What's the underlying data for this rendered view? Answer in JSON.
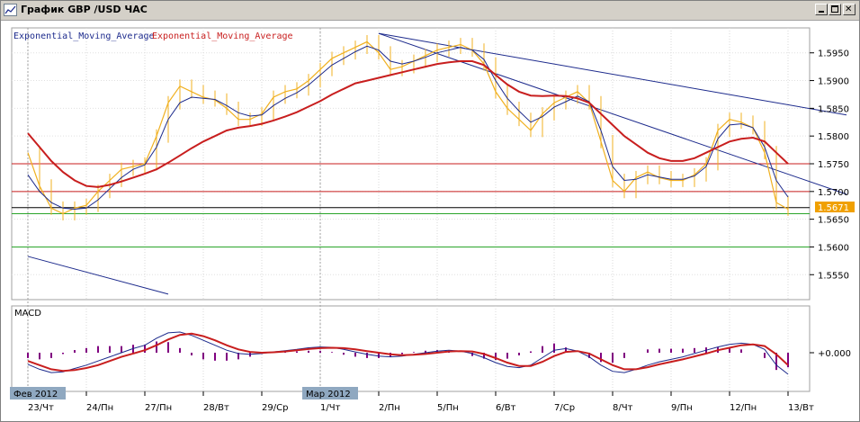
{
  "window": {
    "title": "График GBP /USD ЧАС",
    "buttons": [
      "minimize",
      "maximize",
      "close"
    ]
  },
  "chart_data": [
    {
      "type": "line",
      "name": "price-panel",
      "legend": [
        {
          "label": "Exponential_Moving_Average",
          "color": "#1c2a8c"
        },
        {
          "label": "Exponential_Moving_Average",
          "color": "#c81e1e"
        }
      ],
      "ylim": [
        1.5505,
        1.5995
      ],
      "yticks": [
        "1.5950",
        "1.5900",
        "1.5850",
        "1.5800",
        "1.5750",
        "1.5700",
        "1.5650",
        "1.5600",
        "1.5550"
      ],
      "current_price": "1.5671",
      "colors": {
        "price": "#f0b020",
        "ema_fast": "#1c2a8c",
        "ema_slow": "#c81e1e",
        "hline_red": "#c81e1e",
        "hline_green": "#2aa52a",
        "trend": "#1c2a8c"
      },
      "horizontal_lines": [
        {
          "value": 1.575,
          "color": "#c81e1e"
        },
        {
          "value": 1.57,
          "color": "#c81e1e"
        },
        {
          "value": 1.5671,
          "color": "#000000"
        },
        {
          "value": 1.566,
          "color": "#2aa52a"
        },
        {
          "value": 1.56,
          "color": "#2aa52a"
        }
      ],
      "trendlines": [
        {
          "x1": 6.0,
          "y1": 1.5985,
          "x2": 14.0,
          "y2": 1.5838
        },
        {
          "x1": 6.0,
          "y1": 1.5985,
          "x2": 14.0,
          "y2": 1.5695
        },
        {
          "x1": 0.0,
          "y1": 1.5583,
          "x2": 2.4,
          "y2": 1.5515
        }
      ],
      "x": [
        0.0,
        0.2,
        0.4,
        0.6,
        0.8,
        1.0,
        1.2,
        1.4,
        1.6,
        1.8,
        2.0,
        2.2,
        2.4,
        2.6,
        2.8,
        3.0,
        3.2,
        3.4,
        3.6,
        3.8,
        4.0,
        4.2,
        4.4,
        4.6,
        4.8,
        5.0,
        5.2,
        5.4,
        5.6,
        5.8,
        6.0,
        6.2,
        6.4,
        6.6,
        6.8,
        7.0,
        7.2,
        7.4,
        7.6,
        7.8,
        8.0,
        8.2,
        8.4,
        8.6,
        8.8,
        9.0,
        9.2,
        9.4,
        9.6,
        9.8,
        10.0,
        10.2,
        10.4,
        10.6,
        10.8,
        11.0,
        11.2,
        11.4,
        11.6,
        11.8,
        12.0,
        12.2,
        12.4,
        12.6,
        12.8,
        13.0
      ],
      "series": [
        {
          "role": "price",
          "values": [
            1.577,
            1.571,
            1.567,
            1.566,
            1.567,
            1.5675,
            1.57,
            1.572,
            1.574,
            1.5745,
            1.575,
            1.58,
            1.586,
            1.589,
            1.588,
            1.587,
            1.5865,
            1.585,
            1.583,
            1.583,
            1.584,
            1.587,
            1.588,
            1.5885,
            1.59,
            1.592,
            1.594,
            1.595,
            1.596,
            1.597,
            1.595,
            1.592,
            1.5925,
            1.5935,
            1.5945,
            1.5955,
            1.596,
            1.5965,
            1.5955,
            1.593,
            1.588,
            1.585,
            1.583,
            1.581,
            1.584,
            1.586,
            1.587,
            1.588,
            1.586,
            1.579,
            1.572,
            1.57,
            1.5725,
            1.5735,
            1.5725,
            1.572,
            1.572,
            1.573,
            1.575,
            1.581,
            1.583,
            1.5825,
            1.5815,
            1.577,
            1.568,
            1.5668
          ]
        },
        {
          "role": "ema_fast",
          "values": [
            1.573,
            1.57,
            1.568,
            1.567,
            1.5668,
            1.567,
            1.5685,
            1.5705,
            1.5725,
            1.574,
            1.5748,
            1.578,
            1.583,
            1.586,
            1.587,
            1.5868,
            1.5866,
            1.5855,
            1.5842,
            1.5836,
            1.5838,
            1.5855,
            1.5868,
            1.5878,
            1.5892,
            1.591,
            1.5928,
            1.594,
            1.5952,
            1.5962,
            1.5955,
            1.5935,
            1.593,
            1.5935,
            1.5942,
            1.595,
            1.5955,
            1.596,
            1.5955,
            1.5938,
            1.59,
            1.5868,
            1.5845,
            1.5825,
            1.5835,
            1.5852,
            1.5862,
            1.5872,
            1.5862,
            1.581,
            1.5745,
            1.572,
            1.5722,
            1.573,
            1.5726,
            1.5722,
            1.5722,
            1.5728,
            1.5745,
            1.5795,
            1.582,
            1.5822,
            1.5815,
            1.578,
            1.572,
            1.569
          ]
        },
        {
          "role": "ema_slow",
          "values": [
            1.5805,
            1.578,
            1.5755,
            1.5735,
            1.572,
            1.571,
            1.5708,
            1.5712,
            1.5718,
            1.5725,
            1.5732,
            1.574,
            1.5752,
            1.5765,
            1.5778,
            1.579,
            1.58,
            1.581,
            1.5815,
            1.5818,
            1.5822,
            1.5828,
            1.5835,
            1.5843,
            1.5853,
            1.5863,
            1.5875,
            1.5885,
            1.5895,
            1.59,
            1.5905,
            1.591,
            1.5915,
            1.592,
            1.5925,
            1.593,
            1.5933,
            1.5935,
            1.5935,
            1.5928,
            1.591,
            1.5893,
            1.588,
            1.5873,
            1.5872,
            1.5873,
            1.5872,
            1.5868,
            1.586,
            1.584,
            1.582,
            1.58,
            1.5785,
            1.577,
            1.576,
            1.5755,
            1.5755,
            1.576,
            1.577,
            1.578,
            1.579,
            1.5795,
            1.5797,
            1.579,
            1.577,
            1.575
          ]
        }
      ]
    },
    {
      "type": "line",
      "name": "macd-panel",
      "title": "MACD",
      "zero_label": "+0.000",
      "colors": {
        "macd": "#1c2a8c",
        "signal": "#c81e1e",
        "histogram": "#800080"
      },
      "series": [
        {
          "role": "macd",
          "values": [
            -0.0028,
            -0.004,
            -0.0048,
            -0.0046,
            -0.0038,
            -0.003,
            -0.002,
            -0.001,
            0.0,
            0.001,
            0.0018,
            0.0035,
            0.0048,
            0.005,
            0.0042,
            0.003,
            0.0018,
            0.0006,
            -0.0002,
            -0.0004,
            -0.0002,
            0.0002,
            0.0005,
            0.0008,
            0.0012,
            0.0014,
            0.0013,
            0.0008,
            0.0002,
            -0.0004,
            -0.0008,
            -0.001,
            -0.0008,
            -0.0004,
            0.0,
            0.0004,
            0.0006,
            0.0004,
            -0.0002,
            -0.0012,
            -0.0024,
            -0.0033,
            -0.0036,
            -0.003,
            -0.0012,
            0.0006,
            0.001,
            0.0004,
            -0.001,
            -0.003,
            -0.0045,
            -0.0048,
            -0.004,
            -0.003,
            -0.0022,
            -0.0016,
            -0.001,
            -0.0002,
            0.0006,
            0.0014,
            0.002,
            0.0023,
            0.002,
            0.0008,
            -0.003,
            -0.0052
          ]
        },
        {
          "role": "signal",
          "values": [
            -0.002,
            -0.003,
            -0.004,
            -0.0044,
            -0.0042,
            -0.0037,
            -0.003,
            -0.002,
            -0.001,
            -0.0002,
            0.0006,
            0.0018,
            0.0032,
            0.0043,
            0.0046,
            0.004,
            0.003,
            0.0018,
            0.0008,
            0.0002,
            0.0,
            0.0001,
            0.0003,
            0.0006,
            0.0009,
            0.0011,
            0.0012,
            0.0011,
            0.0008,
            0.0004,
            0.0,
            -0.0004,
            -0.0006,
            -0.0005,
            -0.0003,
            0.0,
            0.0003,
            0.0004,
            0.0003,
            -0.0003,
            -0.0013,
            -0.0024,
            -0.0032,
            -0.0032,
            -0.0022,
            -0.0008,
            0.0002,
            0.0004,
            -0.0002,
            -0.0016,
            -0.003,
            -0.004,
            -0.004,
            -0.0035,
            -0.0028,
            -0.0022,
            -0.0016,
            -0.0009,
            -0.0002,
            0.0006,
            0.0012,
            0.0018,
            0.002,
            0.0016,
            -0.0004,
            -0.003
          ]
        }
      ]
    }
  ],
  "x_axis": {
    "labels": [
      {
        "x": 0.0,
        "text": "23/Чт"
      },
      {
        "x": 1.0,
        "text": "24/Пн"
      },
      {
        "x": 2.0,
        "text": "27/Пн"
      },
      {
        "x": 3.0,
        "text": "28/Вт"
      },
      {
        "x": 4.0,
        "text": "29/Ср"
      },
      {
        "x": 5.0,
        "text": "1/Чт"
      },
      {
        "x": 6.0,
        "text": "2/Пн"
      },
      {
        "x": 7.0,
        "text": "5/Пн"
      },
      {
        "x": 8.0,
        "text": "6/Вт"
      },
      {
        "x": 9.0,
        "text": "7/Ср"
      },
      {
        "x": 10.0,
        "text": "8/Чт"
      },
      {
        "x": 11.0,
        "text": "9/Пн"
      },
      {
        "x": 12.0,
        "text": "12/Пн"
      },
      {
        "x": 13.0,
        "text": "13/Вт"
      }
    ],
    "month_tags": [
      {
        "x": 0.0,
        "text": "Фев 2012"
      },
      {
        "x": 5.0,
        "text": "Мар 2012"
      }
    ]
  }
}
